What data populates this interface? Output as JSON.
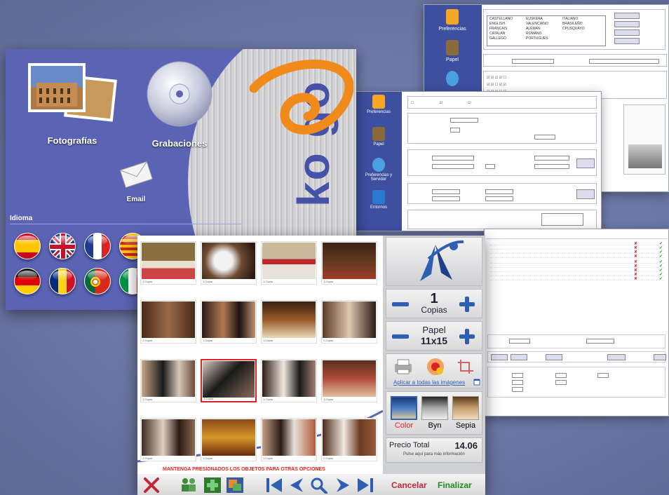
{
  "menu": {
    "items": [
      {
        "label": "Fotografías"
      },
      {
        "label": "Grabaciones"
      },
      {
        "label": "Email"
      }
    ],
    "idioma_label": "Idioma",
    "brand_text": "ko go",
    "flags": [
      "spain",
      "uk",
      "france",
      "catalonia",
      "germany",
      "romania",
      "portugal",
      "italy"
    ]
  },
  "photos": {
    "warning": "MANTENGA PRESIONADOS LOS OBJETOS PARA OTRAS OPCIONES",
    "thumb_caption": "1 Copia",
    "copies": {
      "value": "1",
      "label": "Copias"
    },
    "paper": {
      "label": "Papel",
      "value": "11x15"
    },
    "apply_all": "Aplicar a todas las imágenes",
    "color_options": [
      {
        "label": "Color",
        "color": "#e52222"
      },
      {
        "label": "Byn",
        "color": "#333333"
      },
      {
        "label": "Sepia",
        "color": "#333333"
      }
    ],
    "total": {
      "label": "Precio Total",
      "value": "14.06",
      "hint": "Pulse aquí para más información"
    },
    "cancel": "Cancelar",
    "finish": "Finalizar"
  },
  "settings_window": {
    "sidebar": [
      "Preferencias",
      "Papel"
    ],
    "languages": [
      "CASTELLANO",
      "ENGLISH",
      "FRANCAIS",
      "CATALAN",
      "GALLEGO",
      "EUSKERA",
      "VALENCIANO",
      "ALEMAN",
      "ROMANO",
      "PORTUGUES",
      "ITALIANO",
      "BRASILEÑO",
      "CPUSQUAYO"
    ]
  },
  "form_window": {
    "sidebar": [
      "Preferencias",
      "Papel",
      "Preferencias y Servidor",
      "Entornos"
    ]
  },
  "colors": {
    "menu_bg": "#5b64b4",
    "accent_blue": "#2f5fb3",
    "cancel_red": "#c0283a",
    "finish_green": "#1f8a1f",
    "swirl_orange": "#f08a1a"
  }
}
